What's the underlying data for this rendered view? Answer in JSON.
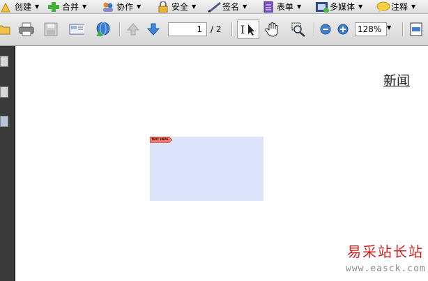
{
  "menubar": {
    "items": [
      {
        "label": "创建",
        "icon": "create-icon"
      },
      {
        "label": "合并",
        "icon": "combine-icon"
      },
      {
        "label": "协作",
        "icon": "collaborate-icon"
      },
      {
        "label": "安全",
        "icon": "lock-icon"
      },
      {
        "label": "签名",
        "icon": "pen-icon"
      },
      {
        "label": "表单",
        "icon": "form-icon"
      },
      {
        "label": "多媒体",
        "icon": "film-icon"
      },
      {
        "label": "注释",
        "icon": "comment-icon"
      }
    ]
  },
  "toolbar": {
    "page_current": "1",
    "page_total": "/ 2",
    "zoom": "128%"
  },
  "document": {
    "heading": "新闻",
    "annotation_flag": "TEXT HERE"
  },
  "watermark": {
    "brand": "易采站长站",
    "url": "www.easck.com"
  },
  "colors": {
    "annotation_fill": "#dde3fb",
    "flag_fill": "#f27a6b",
    "watermark_red": "#d51d1d"
  }
}
